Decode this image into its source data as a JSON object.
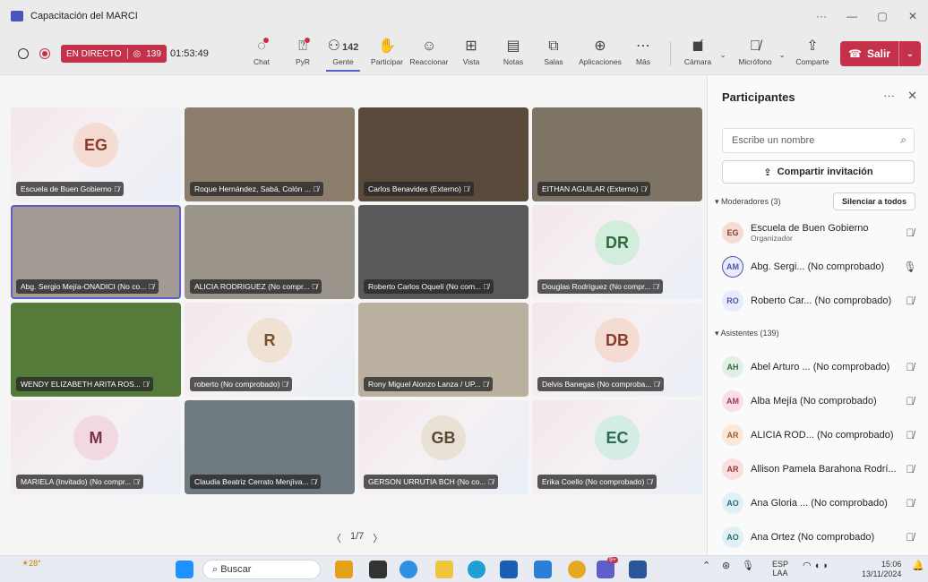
{
  "window": {
    "title": "Capacitación del MARCI",
    "more": "···",
    "minimize": "—",
    "restore": "▢",
    "close": "✕"
  },
  "toolbar": {
    "live_label": "EN DIRECTO",
    "viewers": "139",
    "timer": "01:53:49",
    "buttons": [
      {
        "label": "Chat",
        "icon": "chat-icon"
      },
      {
        "label": "PyR",
        "icon": "qa-icon"
      },
      {
        "label": "Gente",
        "icon": "people-icon",
        "count": "142"
      },
      {
        "label": "Participar",
        "icon": "hand-icon"
      },
      {
        "label": "Reaccionar",
        "icon": "smile-icon"
      },
      {
        "label": "Vista",
        "icon": "grid-icon"
      },
      {
        "label": "Notas",
        "icon": "notes-icon"
      },
      {
        "label": "Salas",
        "icon": "rooms-icon"
      },
      {
        "label": "Aplicaciones",
        "icon": "apps-icon"
      },
      {
        "label": "Más",
        "icon": "more-icon"
      },
      {
        "label": "Cámara",
        "icon": "camera-off-icon"
      },
      {
        "label": "Micrófono",
        "icon": "mic-off-icon"
      },
      {
        "label": "Comparte",
        "icon": "share-icon"
      }
    ],
    "leave_label": "Salir"
  },
  "tiles": [
    {
      "name": "Escuela de Buen Gobierno",
      "initials": "EG",
      "type": "avatar",
      "bg": "#f5dcd3",
      "fg": "#8a3b2b"
    },
    {
      "name": "Roque Hernández, Sabá, Colón ...",
      "type": "video",
      "bg": "#8a7d6c"
    },
    {
      "name": "Carlos Benavides (Externo)",
      "type": "video",
      "bg": "#5a4a3c"
    },
    {
      "name": "EITHAN AGUILAR (Externo)",
      "type": "video",
      "bg": "#7d7466"
    },
    {
      "name": "Abg. Sergio Mejía-ONADICI (No co...",
      "type": "video",
      "bg": "#a29a93",
      "selected": true
    },
    {
      "name": "ALICIA RODRIGUEZ (No compr...",
      "type": "video",
      "bg": "#9b948b"
    },
    {
      "name": "Roberto Carlos Oquelí (No com...",
      "type": "video",
      "bg": "#5a5a5c"
    },
    {
      "name": "Douglas Rodríguez (No compr...",
      "initials": "DR",
      "type": "avatar",
      "bg": "#d3eddc",
      "fg": "#2d6b3f"
    },
    {
      "name": "WENDY ELIZABETH ARITA ROS...",
      "type": "video",
      "bg": "#557b3a"
    },
    {
      "name": "roberto (No comprobado)",
      "initials": "R",
      "type": "avatar",
      "bg": "#efe1d3",
      "fg": "#7a4f26"
    },
    {
      "name": "Rony Miguel Alonzo Lanza / UP...",
      "type": "video",
      "bg": "#b9b09f"
    },
    {
      "name": "Delvis Banegas (No comproba...",
      "initials": "DB",
      "type": "avatar",
      "bg": "#f5dcd3",
      "fg": "#8a3b2b"
    },
    {
      "name": "MARIELA (Invitado) (No compr...",
      "initials": "M",
      "type": "avatar",
      "bg": "#f2d9e1",
      "fg": "#7a2f4a"
    },
    {
      "name": "Claudia Beatriz Cerrato Menjíva...",
      "type": "video",
      "bg": "#6f7a80"
    },
    {
      "name": "GERSON URRUTIA BCH (No co...",
      "initials": "GB",
      "type": "avatar",
      "bg": "#e8e1d6",
      "fg": "#5a4a32"
    },
    {
      "name": "Erika Coello (No comprobado)",
      "initials": "EC",
      "type": "avatar",
      "bg": "#d3ede4",
      "fg": "#2d6b56"
    }
  ],
  "pager": {
    "prev": "〈",
    "text": "1/7",
    "next": "〉"
  },
  "panel": {
    "title": "Participantes",
    "more": "···",
    "close": "✕",
    "search_placeholder": "Escribe un nombre",
    "invite_label": "Compartir invitación",
    "moderators_header": "Moderadores (3)",
    "mute_all": "Silenciar a todos",
    "attendees_header": "Asistentes (139)",
    "moderators": [
      {
        "initials": "EG",
        "name": "Escuela de Buen Gobierno",
        "sub": "Organizador",
        "bg": "#f5dcd3",
        "fg": "#8a3b2b",
        "mic": "muted"
      },
      {
        "initials": "AM",
        "name": "Abg. Sergi... (No comprobado)",
        "bg": "#e8ebfa",
        "fg": "#4f52b2",
        "mic": "on"
      },
      {
        "initials": "RO",
        "name": "Roberto Car... (No comprobado)",
        "bg": "#e8ebfa",
        "fg": "#4f52b2",
        "mic": "muted"
      }
    ],
    "attendees": [
      {
        "initials": "AH",
        "name": "Abel Arturo ... (No comprobado)",
        "bg": "#e0f0e6",
        "fg": "#2d6b3f"
      },
      {
        "initials": "AM",
        "name": "Alba Mejía (No comprobado)",
        "bg": "#f8e0e8",
        "fg": "#a3365a"
      },
      {
        "initials": "AR",
        "name": "ALICIA ROD... (No comprobado)",
        "bg": "#f9e8d8",
        "fg": "#a35a1c"
      },
      {
        "initials": "AR",
        "name": "Allison Pamela Barahona Rodrí...",
        "bg": "#f8e0e0",
        "fg": "#a33636"
      },
      {
        "initials": "AO",
        "name": "Ana Gloria ... (No comprobado)",
        "bg": "#dff1f5",
        "fg": "#2b6b7a"
      },
      {
        "initials": "AO",
        "name": "Ana Ortez (No comprobado)",
        "bg": "#dff1f5",
        "fg": "#2b6b7a"
      }
    ]
  },
  "taskbar": {
    "weather": "28°",
    "search": "Buscar",
    "lang": "ESP",
    "lang2": "LAA",
    "time": "15:06",
    "date": "13/11/2024",
    "teams_badge": "9+"
  }
}
